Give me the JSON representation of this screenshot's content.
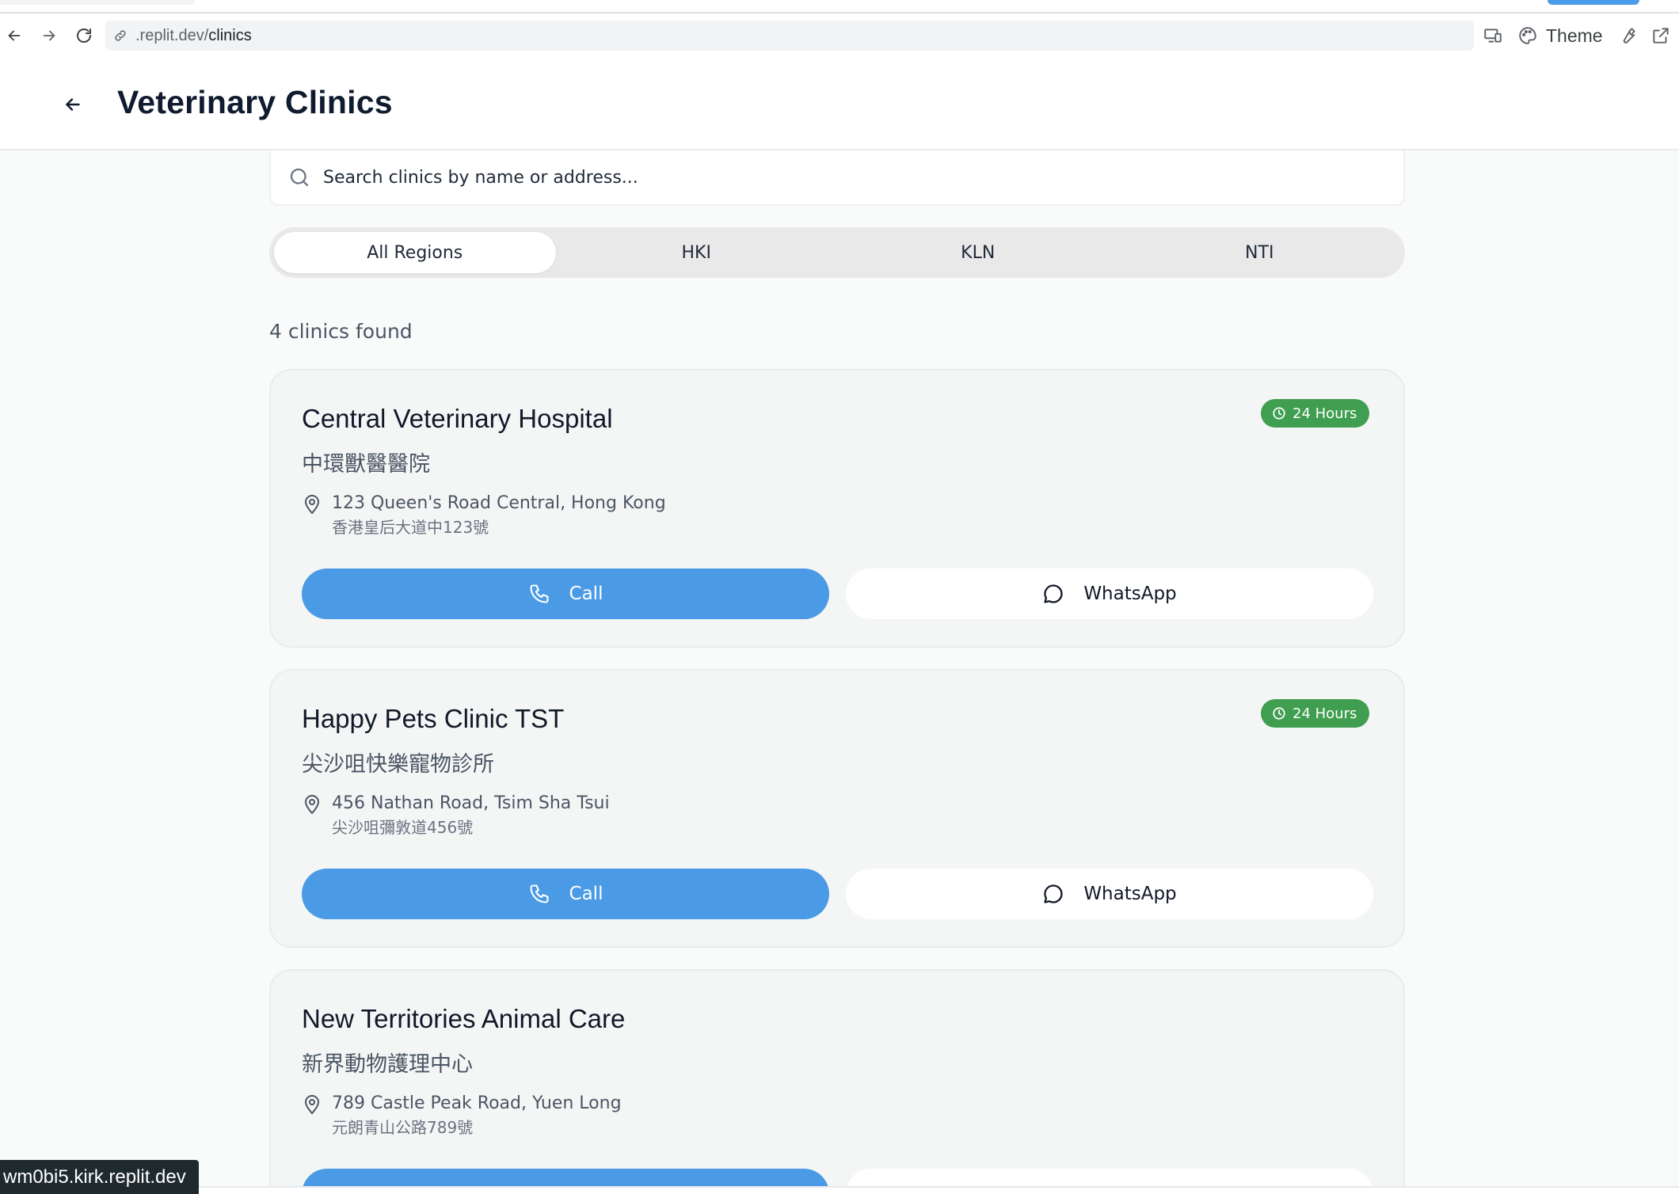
{
  "browser": {
    "url_host": ".replit.dev/",
    "url_path": "clinics",
    "theme_label": "Theme",
    "status_url": "wm0bi5.kirk.replit.dev"
  },
  "header": {
    "title": "Veterinary Clinics"
  },
  "search": {
    "placeholder": "Search clinics by name or address..."
  },
  "region_tabs": [
    {
      "label": "All Regions",
      "active": true
    },
    {
      "label": "HKI",
      "active": false
    },
    {
      "label": "KLN",
      "active": false
    },
    {
      "label": "NTI",
      "active": false
    }
  ],
  "results": {
    "count_text": "4 clinics found"
  },
  "clinics": [
    {
      "name": "Central Veterinary Hospital",
      "name_zh": "中環獸醫醫院",
      "address_en": "123 Queen's Road Central, Hong Kong",
      "address_zh": "香港皇后大道中123號",
      "badge": "24 Hours",
      "call_label": "Call",
      "whatsapp_label": "WhatsApp"
    },
    {
      "name": "Happy Pets Clinic TST",
      "name_zh": "尖沙咀快樂寵物診所",
      "address_en": "456 Nathan Road, Tsim Sha Tsui",
      "address_zh": "尖沙咀彌敦道456號",
      "badge": "24 Hours",
      "call_label": "Call",
      "whatsapp_label": "WhatsApp"
    },
    {
      "name": "New Territories Animal Care",
      "name_zh": "新界動物護理中心",
      "address_en": "789 Castle Peak Road, Yuen Long",
      "address_zh": "元朗青山公路789號",
      "badge": "",
      "call_label": "",
      "whatsapp_label": ""
    }
  ],
  "colors": {
    "primary": "#4a9ae6",
    "badge_green": "#3f9e4f",
    "title_navy": "#0f1b2e"
  },
  "icons": [
    "back-arrow-icon",
    "forward-arrow-icon",
    "reload-icon",
    "link-icon",
    "devices-icon",
    "palette-icon",
    "wrench-icon",
    "external-link-icon",
    "search-icon",
    "clock-icon",
    "map-pin-icon",
    "phone-icon",
    "chat-bubble-icon"
  ]
}
